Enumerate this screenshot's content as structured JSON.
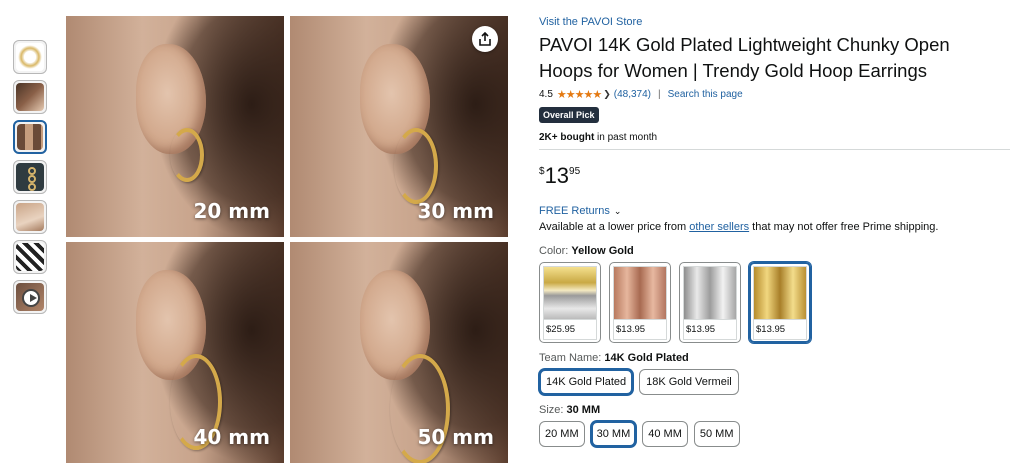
{
  "thumbnails": [
    {
      "icon": "hoop-earring-thumbnail",
      "active": false
    },
    {
      "icon": "model-portrait-thumbnail",
      "active": false
    },
    {
      "icon": "size-comparison-thumbnail",
      "active": true
    },
    {
      "icon": "product-card-thumbnail",
      "active": false
    },
    {
      "icon": "model-closeup-thumbnail",
      "active": false
    },
    {
      "icon": "pattern-thumbnail",
      "active": false
    },
    {
      "icon": "video-play-thumbnail",
      "active": false
    }
  ],
  "gallery": {
    "sizes": [
      "20 mm",
      "30 mm",
      "40 mm",
      "50 mm"
    ],
    "share_icon": "share-icon"
  },
  "product": {
    "store_link": "Visit the PAVOI Store",
    "title": "PAVOI 14K Gold Plated Lightweight Chunky Open Hoops for Women | Trendy Gold Hoop Earrings",
    "rating": "4.5",
    "stars": "★★★★★",
    "rating_count": "(48,374)",
    "search_page": "Search this page",
    "badge": "Overall Pick",
    "bought_bold": "2K+ bought",
    "bought_rest": " in past month",
    "price_symbol": "$",
    "price_whole": "13",
    "price_fraction": "95",
    "free_returns": "FREE Returns",
    "lower_pre": "Available at a lower price from ",
    "lower_link": "other sellers",
    "lower_post": " that may not offer free Prime shipping."
  },
  "color": {
    "label": "Color: ",
    "selected": "Yellow Gold",
    "swatches": [
      {
        "price": "$25.95"
      },
      {
        "price": "$13.95"
      },
      {
        "price": "$13.95"
      },
      {
        "price": "$13.95"
      }
    ]
  },
  "team": {
    "label": "Team Name: ",
    "selected": "14K Gold Plated",
    "options": [
      "14K Gold Plated",
      "18K Gold Vermeil"
    ]
  },
  "size": {
    "label": "Size: ",
    "selected": "30 MM",
    "options": [
      "20 MM",
      "30 MM",
      "40 MM",
      "50 MM"
    ]
  },
  "colors": {
    "link": "#2162a1",
    "star": "#e47911",
    "badge_bg": "#232f3e"
  }
}
